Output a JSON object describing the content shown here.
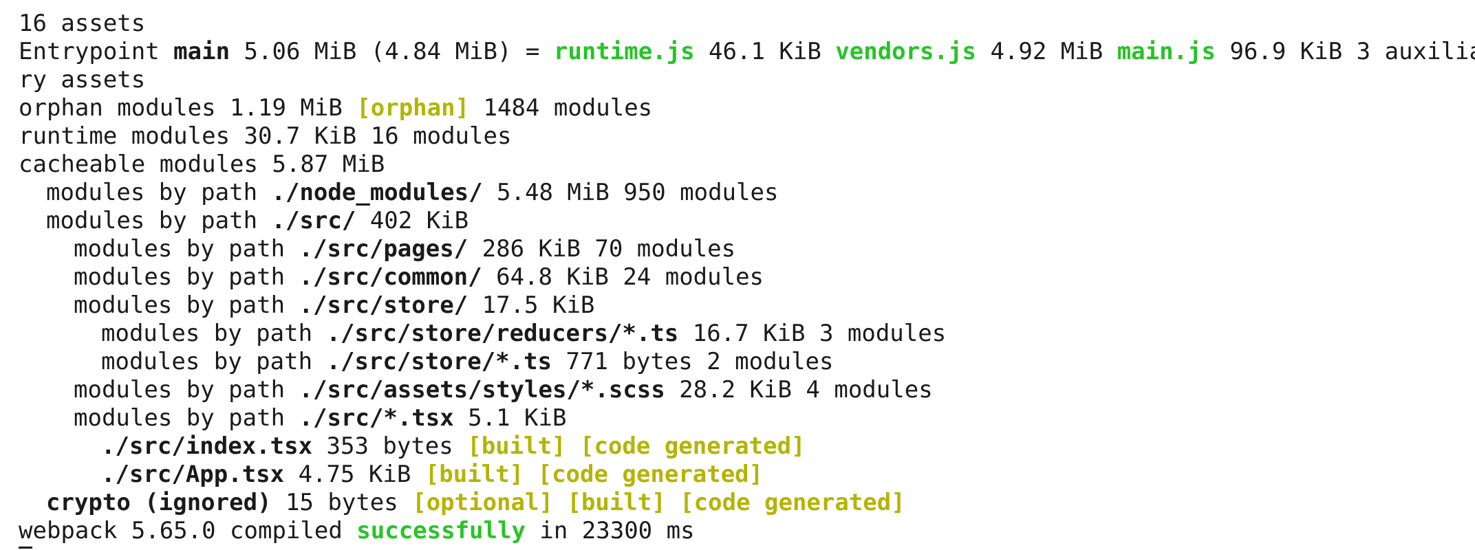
{
  "lines": [
    {
      "parts": [
        "16 assets"
      ]
    },
    {
      "parts": [
        "Entrypoint ",
        "main",
        " 5.06 MiB (4.84 MiB) = ",
        "runtime.js",
        " 46.1 KiB ",
        "vendors.js",
        " 4.92 MiB ",
        "main.js",
        " 96.9 KiB 3 auxilia"
      ]
    },
    {
      "parts": [
        "ry assets"
      ]
    },
    {
      "parts": [
        "orphan modules 1.19 MiB ",
        "[orphan]",
        " 1484 modules"
      ]
    },
    {
      "parts": [
        "runtime modules 30.7 KiB 16 modules"
      ]
    },
    {
      "parts": [
        "cacheable modules 5.87 MiB"
      ]
    },
    {
      "parts": [
        "modules by path ",
        "./node_modules/",
        " 5.48 MiB 950 modules"
      ]
    },
    {
      "parts": [
        "modules by path ",
        "./src/",
        " 402 KiB"
      ]
    },
    {
      "parts": [
        "modules by path ",
        "./src/pages/",
        " 286 KiB 70 modules"
      ]
    },
    {
      "parts": [
        "modules by path ",
        "./src/common/",
        " 64.8 KiB 24 modules"
      ]
    },
    {
      "parts": [
        "modules by path ",
        "./src/store/",
        " 17.5 KiB"
      ]
    },
    {
      "parts": [
        "modules by path ",
        "./src/store/reducers/*.ts",
        " 16.7 KiB 3 modules"
      ]
    },
    {
      "parts": [
        "modules by path ",
        "./src/store/*.ts",
        " 771 bytes 2 modules"
      ]
    },
    {
      "parts": [
        "modules by path ",
        "./src/assets/styles/*.scss",
        " 28.2 KiB 4 modules"
      ]
    },
    {
      "parts": [
        "modules by path ",
        "./src/*.tsx",
        " 5.1 KiB"
      ]
    },
    {
      "parts": [
        "./src/index.tsx",
        " 353 bytes ",
        "[built]",
        " ",
        "[code generated]"
      ]
    },
    {
      "parts": [
        "./src/App.tsx",
        " 4.75 KiB ",
        "[built]",
        " ",
        "[code generated]"
      ]
    },
    {
      "parts": [
        "crypto (ignored)",
        " 15 bytes ",
        "[optional]",
        " ",
        "[built]",
        " ",
        "[code generated]"
      ]
    },
    {
      "parts": [
        "webpack 5.65.0 compiled ",
        "successfully",
        " in 23300 ms"
      ]
    }
  ],
  "colors": {
    "text": "#1a1a1a",
    "success_green": "#27c426",
    "flag_yellow": "#b4b400",
    "background": "#ffffff"
  }
}
